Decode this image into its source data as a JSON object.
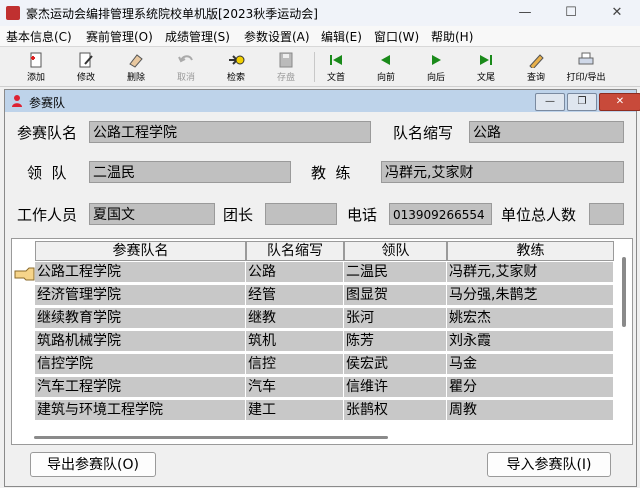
{
  "window": {
    "title": "豪杰运动会编排管理系统院校单机版[2023秋季运动会]"
  },
  "menu": [
    "基本信息(C)",
    "赛前管理(O)",
    "成绩管理(S)",
    "参数设置(A)",
    "编辑(E)",
    "窗口(W)",
    "帮助(H)"
  ],
  "toolbar": {
    "add": "添加",
    "edit": "修改",
    "delete": "删除",
    "cancel": "取消",
    "query": "检索",
    "save": "存盘",
    "first": "文首",
    "prev": "向前",
    "next": "向后",
    "last": "文尾",
    "lookup": "查询",
    "print": "打印/导出"
  },
  "child": {
    "title": "参赛队"
  },
  "form": {
    "team_name_label": "参赛队名",
    "team_name": "公路工程学院",
    "abbr_label": "队名缩写",
    "abbr": "公路",
    "leader_label": "领  队",
    "leader": "二温民",
    "coach_label": "教  练",
    "coach": "冯群元,艾家财",
    "staff_label": "工作人员",
    "staff": "夏国文",
    "captain_label": "团长",
    "captain": "",
    "phone_label": "电话",
    "phone": "013909266554",
    "total_label": "单位总人数",
    "total": ""
  },
  "table": {
    "headers": [
      "参赛队名",
      "队名缩写",
      "领队",
      "教练"
    ],
    "rows": [
      [
        "公路工程学院",
        "公路",
        "二温民",
        "冯群元,艾家财"
      ],
      [
        "经济管理学院",
        "经管",
        "图显贺",
        "马分强,朱鹊芝"
      ],
      [
        "继续教育学院",
        "继教",
        "张河",
        "姚宏杰"
      ],
      [
        "筑路机械学院",
        "筑机",
        "陈芳",
        "刘永霞"
      ],
      [
        "信控学院",
        "信控",
        "侯宏武",
        "马金"
      ],
      [
        "汽车工程学院",
        "汽车",
        "信维许",
        "瞿分"
      ],
      [
        "建筑与环境工程学院",
        "建工",
        "张鹊权",
        "周教"
      ]
    ]
  },
  "buttons": {
    "export": "导出参赛队(O)",
    "import": "导入参赛队(I)"
  }
}
